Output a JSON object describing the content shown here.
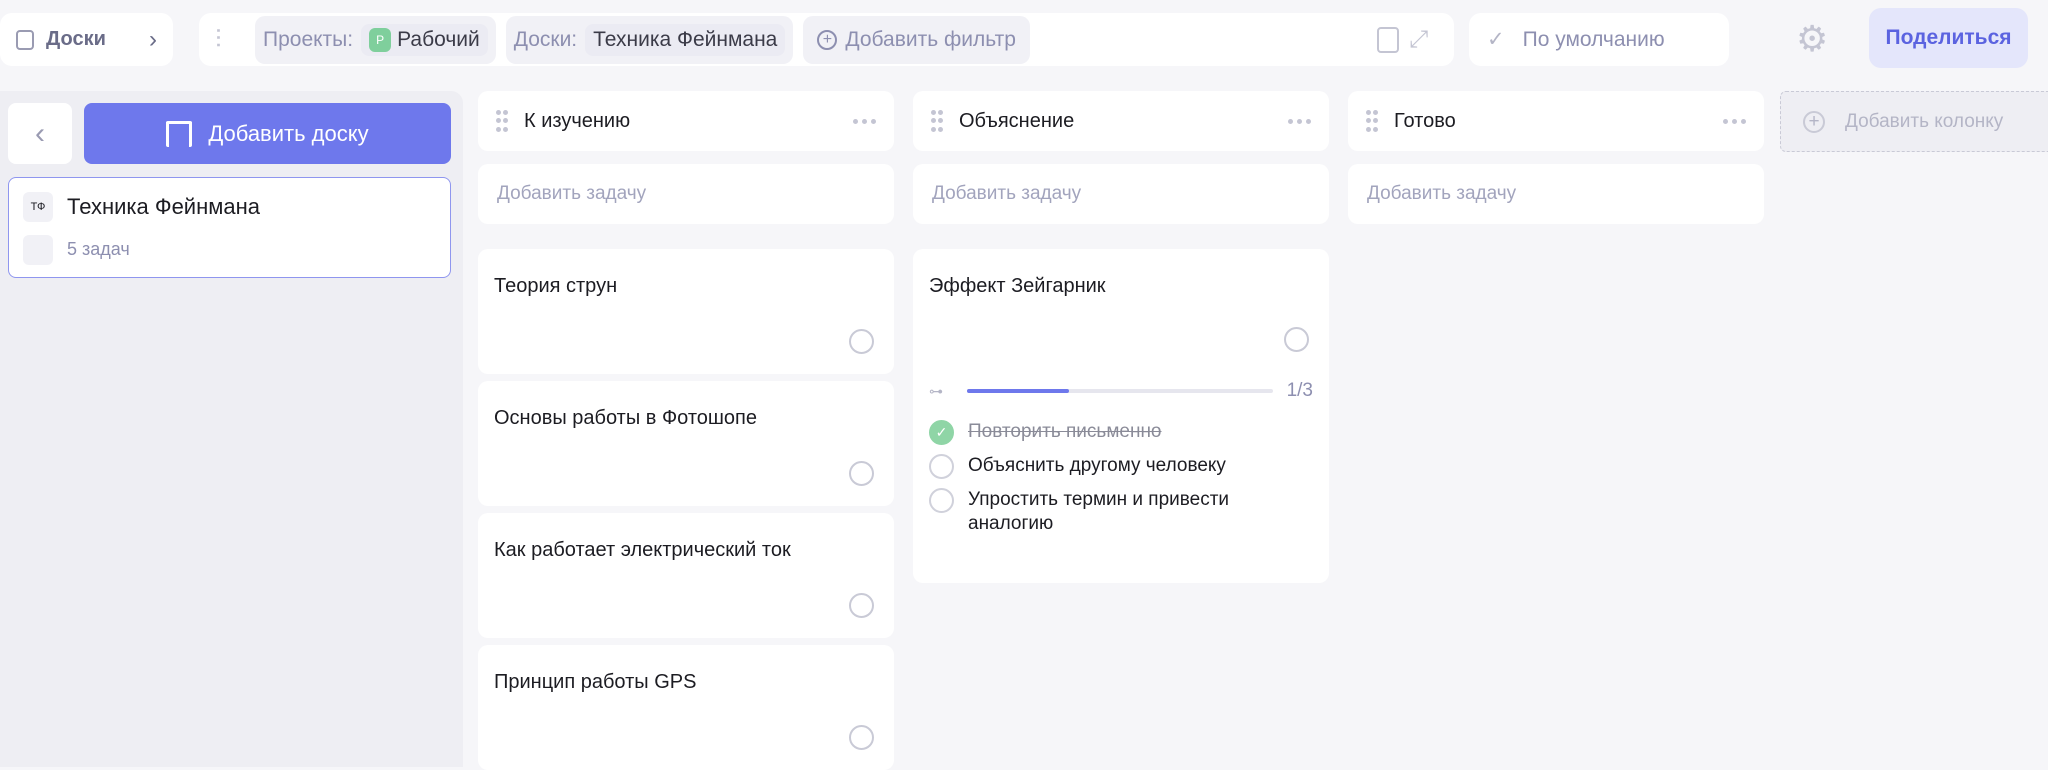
{
  "topbar": {
    "boards_label": "Доски",
    "projects_label": "Проекты:",
    "project_badge": "Р",
    "project_value": "Рабочий",
    "boards_filter_label": "Доски:",
    "boards_filter_value": "Техника Фейнмана",
    "add_filter": "Добавить фильтр",
    "view": "По умолчанию",
    "share": "Поделиться"
  },
  "sidebar": {
    "add_board": "Добавить доску",
    "board": {
      "initials": "ТФ",
      "name": "Техника Фейнмана",
      "count": "5 задач"
    }
  },
  "columns": [
    {
      "title": "К изучению",
      "add_task": "Добавить задачу",
      "cards": [
        {
          "title": "Теория струн"
        },
        {
          "title": "Основы работы в Фотошопе"
        },
        {
          "title": "Как работает электрический ток"
        },
        {
          "title": "Принцип работы GPS"
        }
      ]
    },
    {
      "title": "Объяснение",
      "add_task": "Добавить задачу",
      "cards": [
        {
          "title": "Эффект Зейгарник",
          "progress_text": "1/3",
          "progress": 0.333,
          "subtasks": [
            {
              "text": "Повторить письменно",
              "done": true
            },
            {
              "text": "Объяснить другому человеку",
              "done": false
            },
            {
              "text": "Упростить термин и привести аналогию",
              "done": false
            }
          ]
        }
      ]
    },
    {
      "title": "Готово",
      "add_task": "Добавить задачу",
      "cards": []
    }
  ],
  "add_column": "Добавить колонку",
  "colors": {
    "accent": "#6e78ec",
    "done": "#8fd5a6"
  }
}
